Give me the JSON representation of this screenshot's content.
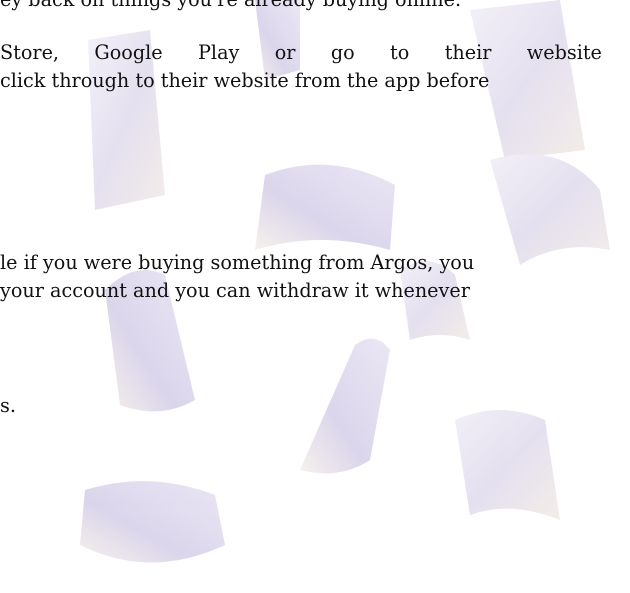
{
  "document": {
    "lines": [
      "ey back on things you're already buying online.",
      "Store, Google Play or go to their website",
      "click through to their website from the app before",
      "le if you were buying something from Argos, you",
      "your account and you can withdraw it whenever",
      "s."
    ],
    "justified_words": [
      "Store,",
      "Google",
      "Play",
      "or",
      "go",
      "to",
      "their",
      "website"
    ]
  }
}
